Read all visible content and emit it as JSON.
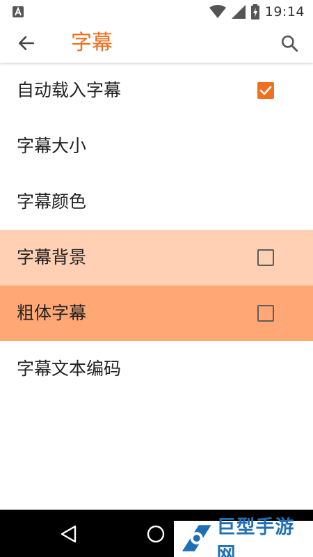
{
  "status_bar": {
    "time": "19:14",
    "left_icon": "notification-a-icon",
    "icons": [
      "wifi-icon",
      "cell-signal-icon",
      "battery-charging-icon"
    ]
  },
  "toolbar": {
    "title": "字幕",
    "back_icon": "arrow-left-icon",
    "search_icon": "search-icon"
  },
  "settings": [
    {
      "label": "自动载入字幕",
      "has_checkbox": true,
      "checked": true,
      "background": "#ffffff"
    },
    {
      "label": "字幕大小",
      "has_checkbox": false,
      "background": "#ffffff"
    },
    {
      "label": "字幕颜色",
      "has_checkbox": false,
      "background": "#ffffff"
    },
    {
      "label": "字幕背景",
      "has_checkbox": true,
      "checked": false,
      "background": "#FFD0B3"
    },
    {
      "label": "粗体字幕",
      "has_checkbox": true,
      "checked": false,
      "background": "#FFA775"
    },
    {
      "label": "字幕文本编码",
      "has_checkbox": false,
      "background": "#ffffff"
    }
  ],
  "nav_bar": {
    "back_icon": "triangle-back-icon",
    "home_icon": "circle-home-icon"
  },
  "watermark": {
    "text": "巨型手游网"
  },
  "colors": {
    "accent": "#F07021",
    "checkbox_border": "#5e5e5e",
    "highlight_light": "#FFD0B3",
    "highlight_strong": "#FFA775",
    "watermark_blue": "#1F6FB5"
  }
}
